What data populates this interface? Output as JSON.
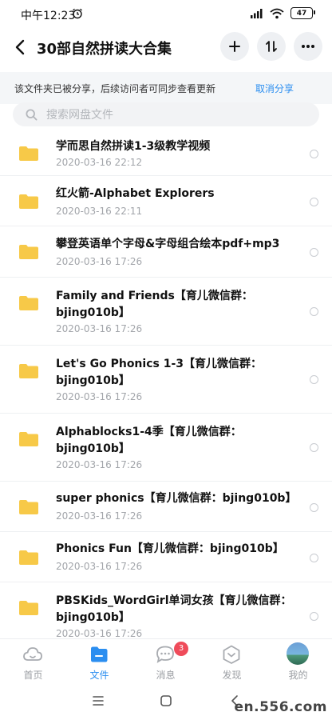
{
  "status_bar": {
    "time": "中午12:23",
    "battery": "47"
  },
  "header": {
    "title": "30部自然拼读大合集"
  },
  "share_banner": {
    "notice": "该文件夹已被分享，后续访问者可同步查看更新",
    "cancel_label": "取消分享"
  },
  "search": {
    "placeholder": "搜索网盘文件"
  },
  "files": [
    {
      "name": "学而思自然拼读1-3级教学视频",
      "date": "2020-03-16  22:12"
    },
    {
      "name": "红火箭-Alphabet Explorers",
      "date": "2020-03-16  22:11"
    },
    {
      "name": "攀登英语单个字母&字母组合绘本pdf+mp3",
      "date": "2020-03-16  17:26"
    },
    {
      "name": "Family and Friends【育儿微信群：bjing010b】",
      "date": "2020-03-16  17:26"
    },
    {
      "name": "Let's Go Phonics 1-3【育儿微信群：bjing010b】",
      "date": "2020-03-16  17:26"
    },
    {
      "name": "Alphablocks1-4季【育儿微信群：bjing010b】",
      "date": "2020-03-16  17:26"
    },
    {
      "name": "super phonics【育儿微信群：bjing010b】",
      "date": "2020-03-16  17:26"
    },
    {
      "name": "Phonics Fun【育儿微信群：bjing010b】",
      "date": "2020-03-16  17:26"
    },
    {
      "name": "PBSKids_WordGirl单词女孩【育儿微信群：bjing010b】",
      "date": "2020-03-16  17:26"
    }
  ],
  "bottom_nav": {
    "items": [
      {
        "label": "首页",
        "icon": "cloud-icon"
      },
      {
        "label": "文件",
        "icon": "file-icon"
      },
      {
        "label": "消息",
        "icon": "message-icon"
      },
      {
        "label": "发现",
        "icon": "discover-icon"
      },
      {
        "label": "我的",
        "icon": "avatar"
      }
    ],
    "active": "文件",
    "message_badge": "3"
  },
  "watermark": "en.556.com",
  "colors": {
    "accent": "#2b8ef0",
    "folder": "#f7c948",
    "badge": "#ef4b5a"
  }
}
